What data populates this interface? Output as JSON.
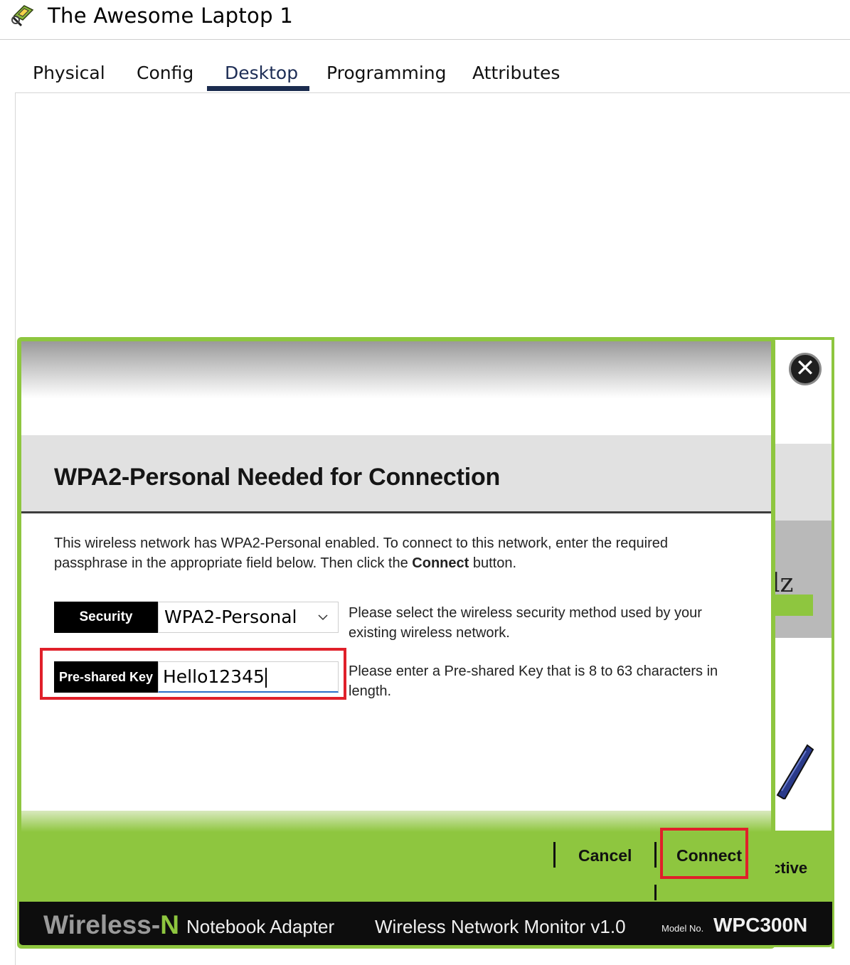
{
  "window": {
    "title": "The Awesome Laptop 1",
    "icon": "laptop-app-icon"
  },
  "tabs": [
    {
      "label": "Physical",
      "active": false
    },
    {
      "label": "Config",
      "active": false
    },
    {
      "label": "Desktop",
      "active": true
    },
    {
      "label": "Programming",
      "active": false
    },
    {
      "label": "Attributes",
      "active": false
    }
  ],
  "dialog": {
    "heading": "WPA2-Personal Needed for Connection",
    "description_part1": "This wireless network has WPA2-Personal enabled. To connect to this network, enter the required passphrase in the appropriate field below. Then click the ",
    "description_bold": "Connect",
    "description_part2": " button.",
    "security": {
      "label": "Security",
      "value": "WPA2-Personal",
      "help": "Please select the wireless security method used by your existing wireless network."
    },
    "psk": {
      "label": "Pre-shared Key",
      "value": "Hello12345",
      "help": "Please enter a Pre-shared Key that is 8 to 63 characters in length."
    },
    "cancel_label": "Cancel",
    "connect_label": "Connect"
  },
  "background_window": {
    "partial_text": "lz",
    "partial_status": "ctive"
  },
  "brand": {
    "wireless": "Wireless-",
    "n": "N",
    "product": "Notebook Adapter",
    "monitor": "Wireless Network Monitor  v1.0",
    "model_label": "Model No.",
    "model": "WPC300N"
  },
  "colors": {
    "accent_green": "#8ec63f",
    "highlight_red": "#e0202a",
    "tab_underline": "#1b2c4f"
  }
}
